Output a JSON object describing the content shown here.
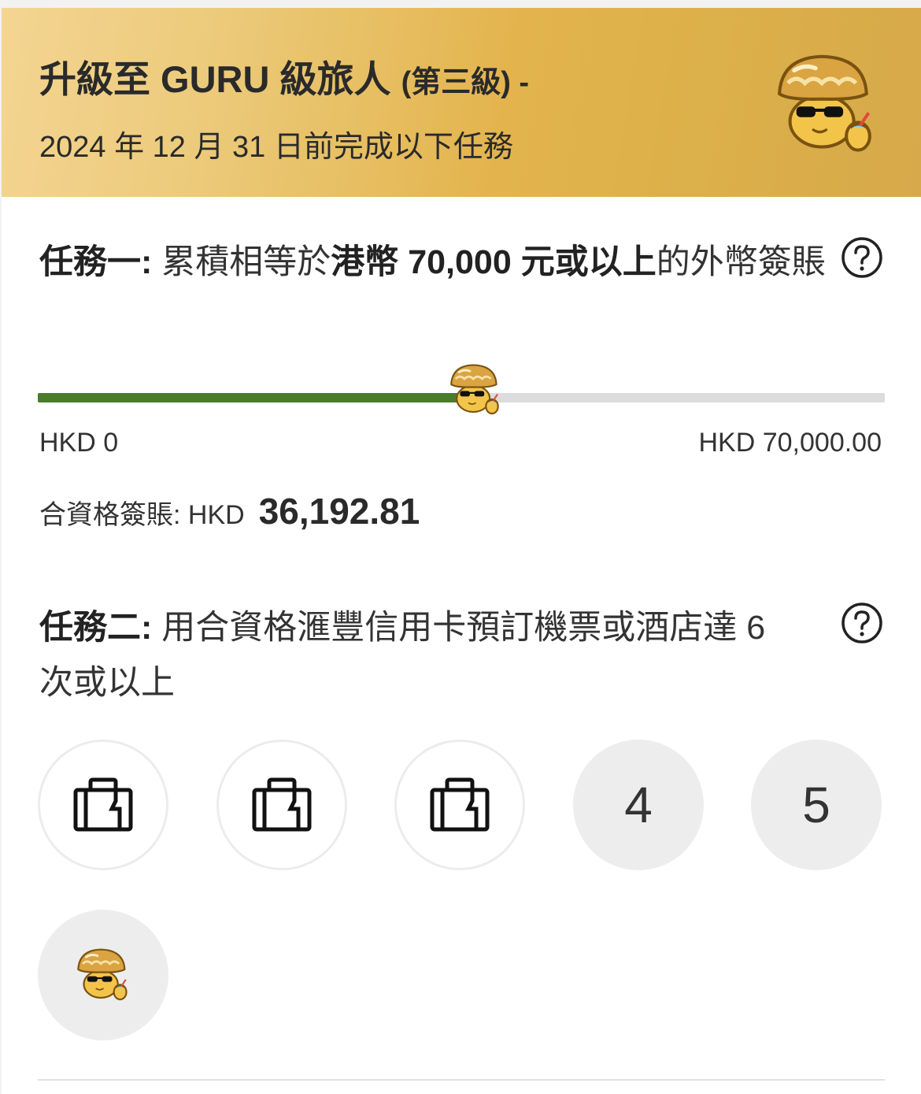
{
  "banner": {
    "title": "升級至 GURU 級旅人",
    "title_suffix": "(第三級) -",
    "subtitle": "2024 年 12 月 31 日前完成以下任務",
    "mascot_icon": "mushroom-mascot-icon"
  },
  "task1": {
    "prefix": "任務一:",
    "text_a": "累積相等於",
    "text_bold": "港幣 70,000 元或以上",
    "text_b": "的外幣簽賬",
    "help_icon": "question-circle-icon",
    "progress": {
      "min_label": "HKD 0",
      "max_label": "HKD 70,000.00",
      "value": 36192.81,
      "max": 70000,
      "fill_color": "#4a7d2a"
    },
    "eligible_label": "合資格簽賬: HKD",
    "eligible_value": "36,192.81"
  },
  "task2": {
    "prefix": "任務二:",
    "text": "用合資格滙豐信用卡預訂機票或酒店達 6 次或以上",
    "help_icon": "question-circle-icon",
    "steps": [
      {
        "state": "done",
        "icon": "luggage-icon"
      },
      {
        "state": "done",
        "icon": "luggage-icon"
      },
      {
        "state": "done",
        "icon": "luggage-icon"
      },
      {
        "state": "todo",
        "label": "4"
      },
      {
        "state": "todo",
        "label": "5"
      },
      {
        "state": "todo",
        "icon": "mushroom-mascot-icon"
      }
    ]
  }
}
